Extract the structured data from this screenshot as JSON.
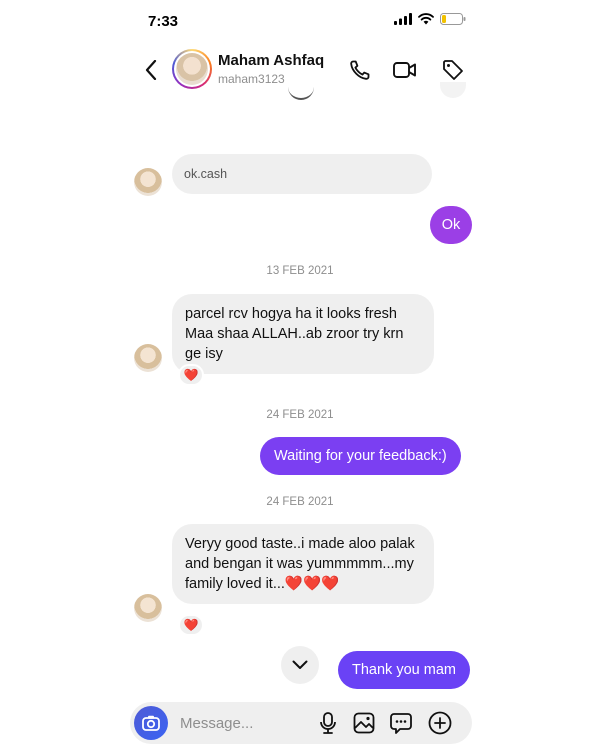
{
  "status_bar": {
    "time": "7:33"
  },
  "header": {
    "name": "Maham Ashfaq",
    "username": "maham3123"
  },
  "messages": {
    "m1": {
      "text": "ok.cash"
    },
    "m2": {
      "text": "Ok"
    },
    "date1": "13 FEB 2021",
    "m3": {
      "text": "parcel rcv hogya ha it looks fresh Maa shaa ALLAH..ab zroor try krn ge isy",
      "reaction": "❤️"
    },
    "date2": "24 FEB 2021",
    "m4": {
      "text": "Waiting for your feedback:)"
    },
    "date3": "24 FEB 2021",
    "m5": {
      "text": "Veryy good taste..i made aloo palak and bengan it was yummmmm...my family loved it...❤️❤️❤️",
      "reaction": "❤️"
    },
    "m6": {
      "text": "Thank you mam"
    }
  },
  "composer": {
    "placeholder": "Message..."
  },
  "colors": {
    "accent_purple": "#8a3ff0",
    "incoming_bg": "#efefef",
    "camera_blue": "#3a63f3"
  },
  "icons": [
    "back-icon",
    "phone-icon",
    "video-icon",
    "tag-icon",
    "camera-icon",
    "mic-icon",
    "gallery-icon",
    "sticker-icon",
    "plus-icon",
    "chevron-down-icon"
  ]
}
